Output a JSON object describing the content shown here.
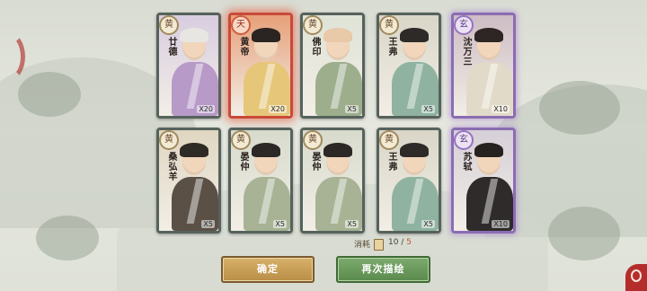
{
  "cards": [
    {
      "rank": "黄",
      "name": "廿德",
      "count": "X20",
      "rarity": "huang",
      "bg": "#d8cde0",
      "hair": "#e8e6e2",
      "robe": "#b79ac8"
    },
    {
      "rank": "天",
      "name": "黄帝",
      "count": "X20",
      "rarity": "tian",
      "bg": "#e7a07a",
      "hair": "#2a2522",
      "robe": "#e6c77a"
    },
    {
      "rank": "黄",
      "name": "佛印",
      "count": "X5",
      "rarity": "huang",
      "bg": "#dfe3d6",
      "hair": "#e8c9a8",
      "robe": "#9dae8c"
    },
    {
      "rank": "黄",
      "name": "王弗",
      "count": "X5",
      "rarity": "huang",
      "bg": "#d9d6c8",
      "hair": "#2e2a28",
      "robe": "#8fb3a0"
    },
    {
      "rank": "玄",
      "name": "沈万三",
      "count": "X10",
      "rarity": "xuan",
      "bg": "#cdbcc4",
      "hair": "#2d2624",
      "robe": "#e2dac8"
    },
    {
      "rank": "黄",
      "name": "桑弘羊",
      "count": "X5",
      "rarity": "huang",
      "bg": "#e0d6c2",
      "hair": "#2e2a26",
      "robe": "#5a5046"
    },
    {
      "rank": "黄",
      "name": "晏仲",
      "count": "X5",
      "rarity": "huang",
      "bg": "#d7dbcc",
      "hair": "#2b2825",
      "robe": "#a7b394"
    },
    {
      "rank": "黄",
      "name": "晏仲",
      "count": "X5",
      "rarity": "huang",
      "bg": "#d7dbcc",
      "hair": "#2b2825",
      "robe": "#a7b394"
    },
    {
      "rank": "黄",
      "name": "王弗",
      "count": "X5",
      "rarity": "huang",
      "bg": "#d9d6c8",
      "hair": "#2e2a28",
      "robe": "#8fb3a0"
    },
    {
      "rank": "玄",
      "name": "苏轼",
      "count": "X10",
      "rarity": "xuan",
      "bg": "#d6cfd8",
      "hair": "#262220",
      "robe": "#2f2b2a"
    }
  ],
  "cost": {
    "label": "消耗",
    "current": "10",
    "separator": "/",
    "max": "5"
  },
  "buttons": {
    "confirm": "确定",
    "redraw": "再次描绘"
  }
}
